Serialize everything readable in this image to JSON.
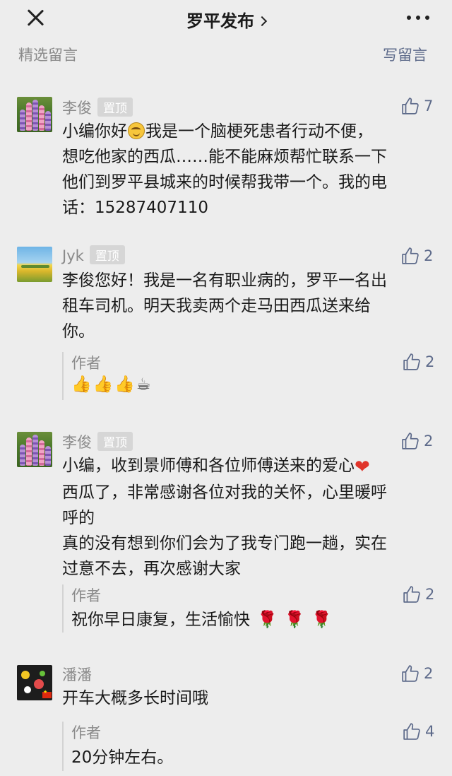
{
  "header": {
    "title": "罗平发布",
    "close_icon": "close-icon",
    "more_icon": "more-icon"
  },
  "section": {
    "label": "精选留言",
    "write_label": "写留言"
  },
  "colors": {
    "background": "#ededed",
    "link": "#5d6a8a",
    "muted": "#8a8a8a",
    "pin_badge": "#d6d6d6"
  },
  "comments": [
    {
      "name": "李俊",
      "pinned_label": "置顶",
      "likes": "7",
      "avatar": "lupine-flowers",
      "text_lines": [
        "小编你好",
        "我是一个脑梗死患者行动不便，",
        "想吃他家的西瓜……能不能麻烦帮忙联系一下",
        "他们到罗平县城来的时候帮我带一个。我的电",
        "话：15287407110"
      ]
    },
    {
      "name": "Jyk",
      "pinned_label": "置顶",
      "likes": "2",
      "avatar": "yellow-field",
      "text_lines": [
        "李俊您好！我是一名有职业病的，罗平一名出",
        "租车司机。明天我卖两个走马田西瓜送来给",
        "你。"
      ],
      "reply": {
        "name": "作者",
        "likes": "2",
        "text": "👍👍👍☕"
      }
    },
    {
      "name": "李俊",
      "pinned_label": "置顶",
      "likes": "2",
      "avatar": "lupine-flowers",
      "text_lines": [
        "小编，收到景师傅和各位师傅送来的爱心",
        "西瓜了，非常感谢各位对我的关怀，心里暖呼",
        "呼的",
        "真的没有想到你们会为了我专门跑一趟，实在",
        "过意不去，再次感谢大家"
      ],
      "reply": {
        "name": "作者",
        "likes": "2",
        "text": "祝你早日康复，生活愉快"
      }
    },
    {
      "name": "潘潘",
      "likes": "2",
      "avatar": "dark-cartoon",
      "text_lines": [
        "开车大概多长时间哦"
      ],
      "reply": {
        "name": "作者",
        "likes": "4",
        "text": "20分钟左右。"
      }
    }
  ]
}
